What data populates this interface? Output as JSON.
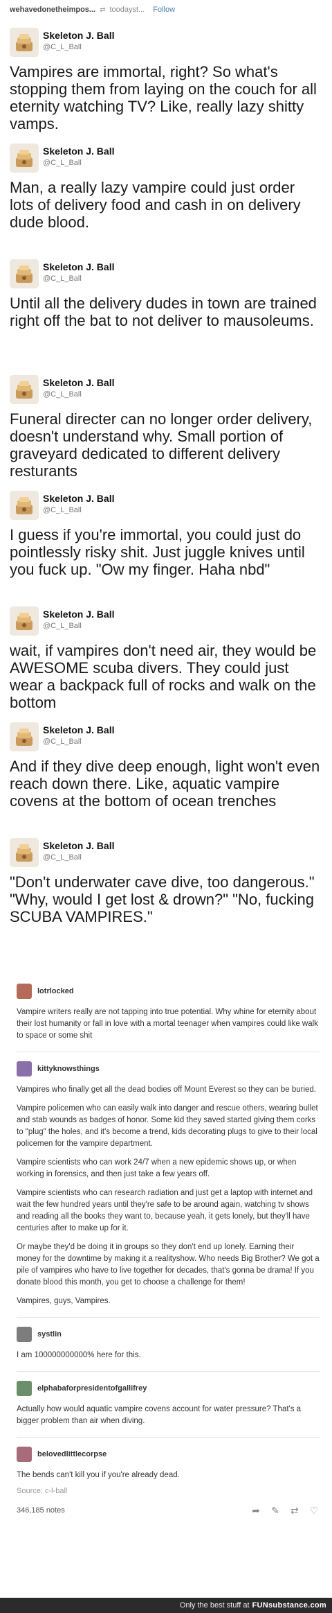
{
  "header": {
    "blog_name": "wehavedonetheimpos...",
    "arrow": "⇄",
    "source_blog": "toodayst...",
    "follow_label": "Follow"
  },
  "tweets": [
    {
      "name": "Skeleton J. Ball",
      "handle": "@C_L_Ball",
      "text": "Vampires are immortal, right? So what's stopping them from laying on the couch for all eternity watching TV? Like, really lazy shitty vamps."
    },
    {
      "name": "Skeleton J. Ball",
      "handle": "@C_L_Ball",
      "text": "Man, a really lazy vampire could just order lots of delivery food and cash in on delivery dude blood."
    },
    {
      "name": "Skeleton J. Ball",
      "handle": "@C_L_Ball",
      "text": "Until all the delivery dudes in town are trained right off the bat to not deliver to mausoleums."
    },
    {
      "name": "Skeleton J. Ball",
      "handle": "@C_L_Ball",
      "text": "Funeral directer can no longer order delivery, doesn't understand why. Small portion of graveyard dedicated to different delivery resturants"
    },
    {
      "name": "Skeleton J. Ball",
      "handle": "@C_L_Ball",
      "text": "I guess if you're immortal, you could just do pointlessly risky shit. Just juggle knives until you fuck up. \"Ow my finger. Haha nbd\""
    },
    {
      "name": "Skeleton J. Ball",
      "handle": "@C_L_Ball",
      "text": "wait, if vampires don't need air, they would be AWESOME scuba divers. They could just wear a backpack full of rocks and walk on the bottom"
    },
    {
      "name": "Skeleton J. Ball",
      "handle": "@C_L_Ball",
      "text": "And if they dive deep enough, light won't even reach down there. Like, aquatic vampire covens at the bottom of ocean trenches"
    },
    {
      "name": "Skeleton J. Ball",
      "handle": "@C_L_Ball",
      "text": "\"Don't underwater cave dive, too dangerous.\" \"Why, would I get lost & drown?\" \"No, fucking SCUBA VAMPIRES.\""
    }
  ],
  "replies": [
    {
      "username": "lotrlocked",
      "avatar_color": "#b56b5a",
      "paragraphs": [
        "Vampire writers really are not tapping into true potential. Why whine for eternity about their lost humanity or fall in love with a mortal teenager when vampires could like walk to space or some shit"
      ]
    },
    {
      "username": "kittyknowsthings",
      "avatar_color": "#8a6fa8",
      "paragraphs": [
        "Vampires who finally get all the dead bodies off Mount Everest so they can be buried.",
        "Vampire policemen who can easily walk into danger and rescue others, wearing bullet and stab wounds as badges of honor. Some kid they saved started giving them corks to \"plug\" the holes, and it's become a trend, kids decorating plugs to give to their local policemen for the vampire department.",
        "Vampire scientists who can work 24/7 when a new epidemic shows up, or when working in forensics, and then just take a few years off.",
        "Vampire scientists who can research radiation and just get a laptop with internet and wait the few hundred years until they're safe to be around again, watching tv shows and reading all the books they want to, because yeah, it gets lonely, but they'll have centuries after to make up for it.",
        "Or maybe they'd be doing it in groups so they don't end up lonely. Earning their money for the downtime by making it a realityshow. Who needs Big Brother? We got a pile of vampires who have to live together for decades, that's gonna be drama! If you donate blood this month, you get to choose a challenge for them!",
        "Vampires, guys, Vampires."
      ]
    },
    {
      "username": "systlin",
      "avatar_color": "#7d7d7d",
      "paragraphs": [
        "I am 100000000000% here for this."
      ]
    },
    {
      "username": "elphabaforpresidentofgallifrey",
      "avatar_color": "#6a8f6a",
      "paragraphs": [
        "Actually how would aquatic vampire covens account for water pressure? That's a bigger problem than air when diving."
      ]
    },
    {
      "username": "belovedlittlecorpse",
      "avatar_color": "#a86b7a",
      "paragraphs": [
        "The bends can't kill you if you're already dead."
      ]
    }
  ],
  "source": "Source: c-l-ball",
  "notes": "346,185 notes",
  "action_icons": [
    "share-icon",
    "comment-icon",
    "reblog-icon",
    "like-icon"
  ],
  "footer": {
    "tagline": "Only the best stuff at",
    "brand": "FUNsubstance.com"
  },
  "colors": {
    "link": "#4a7bb5",
    "footer_bg": "#2b2b2b"
  }
}
